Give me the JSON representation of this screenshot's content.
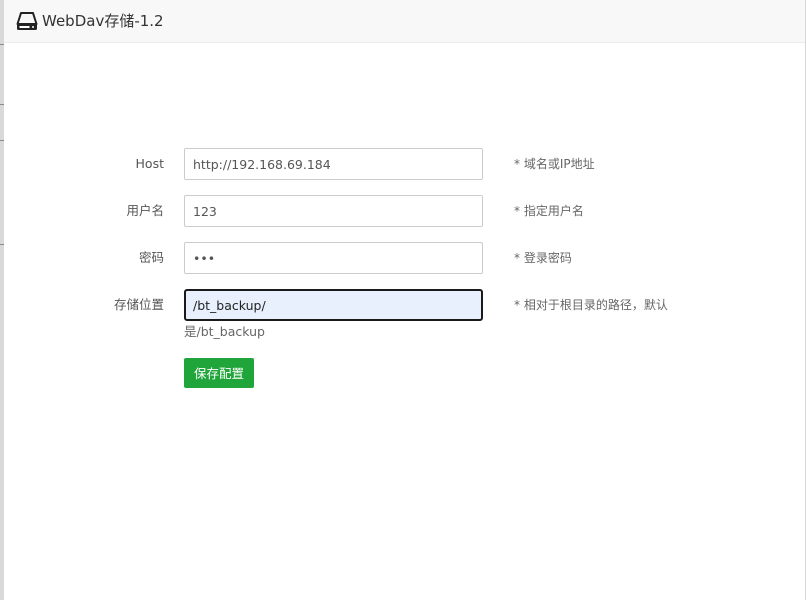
{
  "window": {
    "title": "WebDav存储-1.2"
  },
  "form": {
    "host": {
      "label": "Host",
      "value": "http://192.168.69.184",
      "hint": "* 域名或IP地址"
    },
    "username": {
      "label": "用户名",
      "value": "123",
      "hint": "* 指定用户名"
    },
    "password": {
      "label": "密码",
      "value": "•••",
      "hint": "* 登录密码"
    },
    "path": {
      "label": "存储位置",
      "value": "/bt_backup/",
      "hint": "* 相对于根目录的路径，默认",
      "hint_continued": "是/bt_backup"
    }
  },
  "actions": {
    "save_label": "保存配置"
  },
  "colors": {
    "accent": "#20a53a",
    "focus_bg": "#e8f0fe",
    "titlebar_bg": "#f8f8f8"
  },
  "icons": {
    "title": "hard-drive-icon"
  }
}
